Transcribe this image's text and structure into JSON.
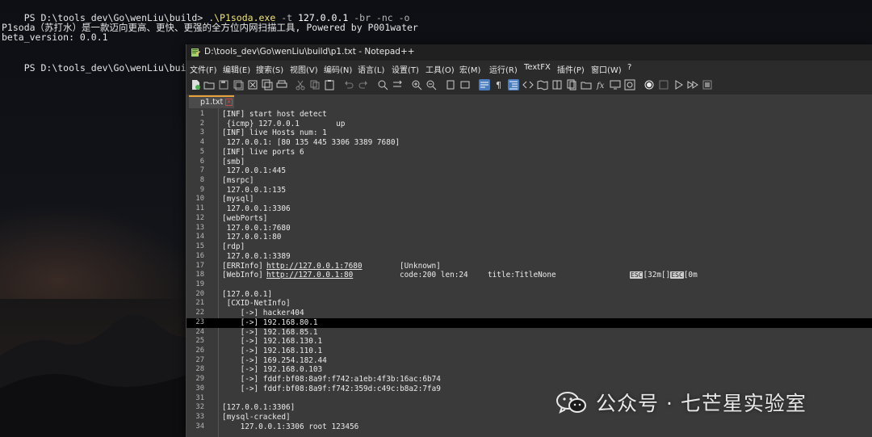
{
  "terminal": {
    "line1_prompt": "PS D:\\tools_dev\\Go\\wenLiu\\build> ",
    "line1_exe": ".\\P1soda.exe",
    "line1_arg1": " -t ",
    "line1_ip": "127.0.0.1",
    "line1_arg2": " -br -nc -o",
    "line3": "P1soda（苏打水）是一款迈向更高、更快、更强的全方位内网扫描工具, Powered by P001water",
    "line4": "beta_version: 0.0.1",
    "line6_prompt": "PS D:\\tools_dev\\Go\\wenLiu\\build> "
  },
  "window": {
    "title": "D:\\tools_dev\\Go\\wenLiu\\build\\p1.txt - Notepad++"
  },
  "menu": [
    "文件(F)",
    "编辑(E)",
    "搜索(S)",
    "视图(V)",
    "编码(N)",
    "语言(L)",
    "设置(T)",
    "工具(O)",
    "宏(M)",
    "运行(R)",
    "TextFX",
    "插件(P)",
    "窗口(W)",
    "?"
  ],
  "tab": {
    "label": "p1.txt",
    "close_icon": "close-icon"
  },
  "editor": {
    "current_line": 23,
    "lines": [
      "[INF] start host detect",
      " {icmp} 127.0.0.1        up",
      "[INF] live Hosts num: 1",
      " 127.0.0.1: [80 135 445 3306 3389 7680]",
      "[INF] live ports 6",
      "[smb]",
      " 127.0.0.1:445",
      "[msrpc]",
      " 127.0.0.1:135",
      "[mysql]",
      " 127.0.0.1:3306",
      "[webPorts]",
      " 127.0.0.1:7680",
      " 127.0.0.1:80",
      "[rdp]",
      " 127.0.0.1:3389",
      "[ERRInfo] ",
      "[WebInfo] ",
      "",
      "[127.0.0.1]",
      " [CXID-NetInfo]",
      "    [->] hacker404",
      "    [->] 192.168.80.1",
      "    [->] 192.168.85.1",
      "    [->] 192.168.130.1",
      "    [->] 192.168.110.1",
      "    [->] 169.254.182.44",
      "    [->] 192.168.0.103",
      "    [->] fddf:bf08:8a9f:f742:a1eb:4f3b:16ac:6b74",
      "    [->] fddf:bf08:8a9f:f742:359d:c49c:b8a2:7fa9",
      "",
      "[127.0.0.1:3306]",
      "[mysql-cracked]",
      "    127.0.0.1:3306 root 123456"
    ],
    "line17_url": "http://127.0.0.1:7680",
    "line17_status": "[Unknown]",
    "line18_url": "http://127.0.0.1:80",
    "line18_code": "code:200 len:24",
    "line18_title": "title:TitleNone",
    "line18_esc1": "ESC",
    "line18_mid": "[32m[]",
    "line18_esc2": "ESC",
    "line18_end": "[0m"
  },
  "watermark": {
    "text": "公众号 · 七芒星实验室",
    "icon": "wechat-icon"
  }
}
